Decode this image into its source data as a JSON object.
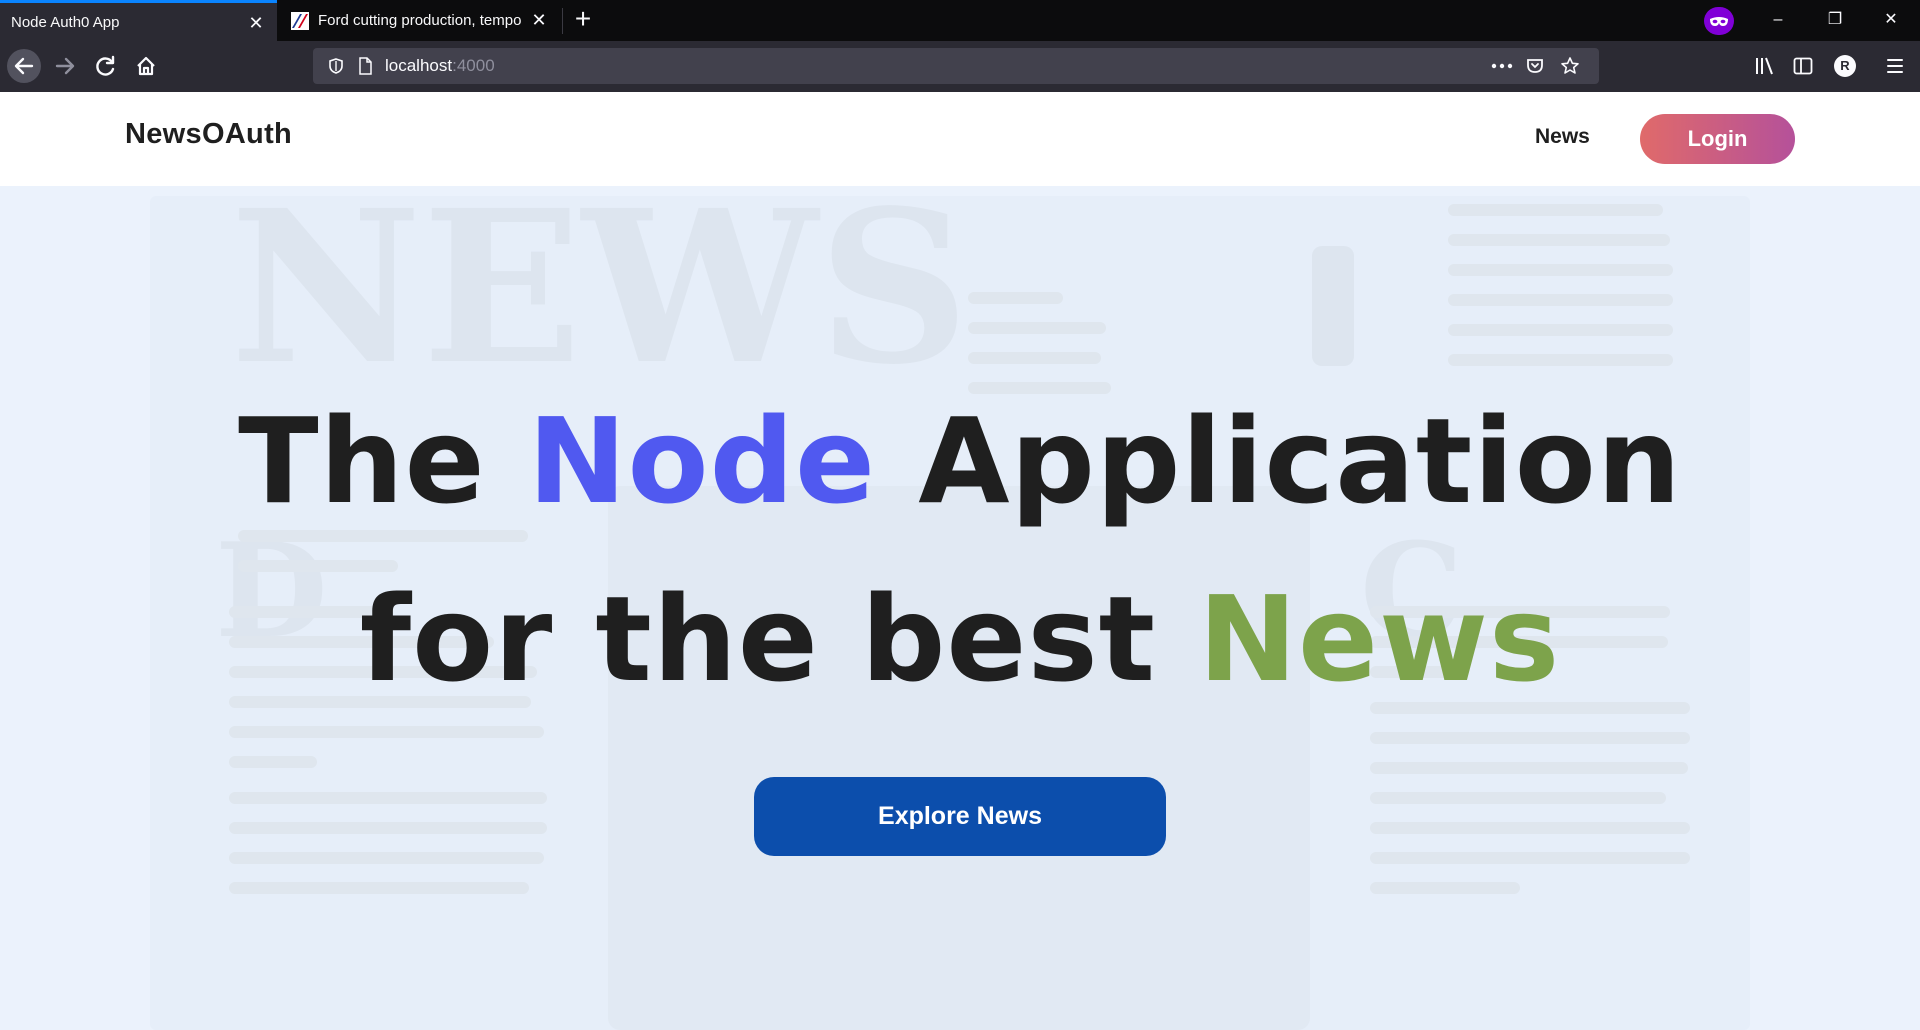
{
  "browser": {
    "tabs": [
      {
        "title": "Node Auth0 App",
        "active": true
      },
      {
        "title": "Ford cutting production, tempo",
        "active": false
      }
    ],
    "new_tab_label": "+",
    "url_host": "localhost",
    "url_port": ":4000",
    "profile_initial": "R",
    "window_controls": {
      "minimize": "–",
      "restore": "❐",
      "close": "✕"
    },
    "accent_color": "#0a84ff",
    "private_badge_color": "#8000d7"
  },
  "site": {
    "brand": "NewsOAuth",
    "nav_news": "News",
    "login_label": "Login"
  },
  "hero": {
    "line1_prefix": "The",
    "line1_highlight": "Node",
    "line1_suffix": "Application",
    "line2_prefix": "for the best",
    "line2_highlight": "News",
    "highlight_colors": {
      "blue": "#5059f0",
      "green": "#7da34b"
    },
    "cta_label": "Explore News",
    "cta_color": "#0c4eac"
  },
  "background_art": {
    "watermark_title": "NEWS",
    "watermark_letter_d": "D",
    "watermark_letter_c": "C"
  }
}
